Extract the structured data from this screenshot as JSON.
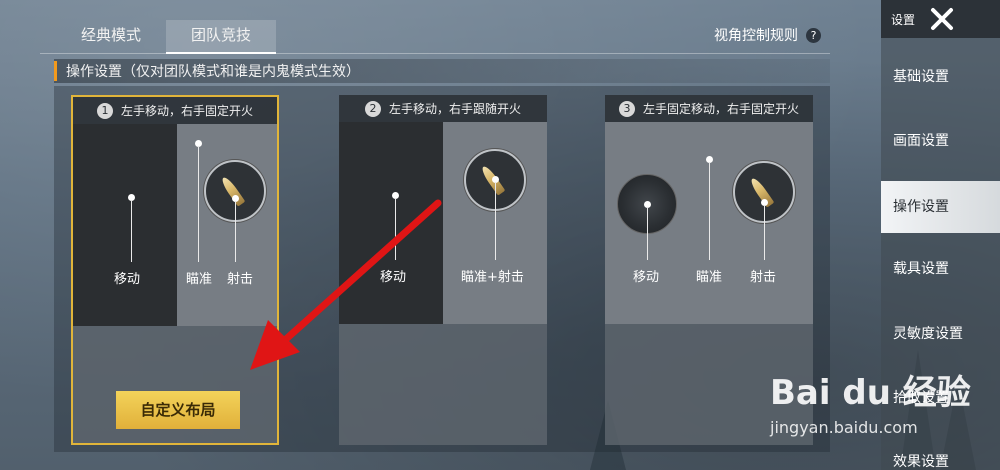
{
  "tabs": [
    {
      "label": "经典模式",
      "active": false
    },
    {
      "label": "团队竞技",
      "active": true
    }
  ],
  "header": {
    "view_rules": "视角控制规则",
    "help": "?"
  },
  "section": {
    "title": "操作设置（仅对团队模式和谁是内鬼模式生效）"
  },
  "cards": [
    {
      "num": "1",
      "title": "左手移动，右手固定开火",
      "selected": true,
      "labels": {
        "move": "移动",
        "aim": "瞄准",
        "shoot": "射击"
      }
    },
    {
      "num": "2",
      "title": "左手移动，右手跟随开火",
      "selected": false,
      "labels": {
        "move": "移动",
        "aim_shoot": "瞄准+射击"
      }
    },
    {
      "num": "3",
      "title": "左手固定移动，右手固定开火",
      "selected": false,
      "labels": {
        "move": "移动",
        "aim": "瞄准",
        "shoot": "射击"
      }
    }
  ],
  "custom_button": "自定义布局",
  "sidebar": {
    "title": "设置",
    "items": [
      {
        "label": "基础设置",
        "active": false
      },
      {
        "label": "画面设置",
        "active": false
      },
      {
        "label": "操作设置",
        "active": true
      },
      {
        "label": "载具设置",
        "active": false
      },
      {
        "label": "灵敏度设置",
        "active": false
      },
      {
        "label": "拾取设置",
        "active": false
      },
      {
        "label": "效果设置",
        "active": false
      }
    ]
  },
  "watermark": {
    "logo": "Bai du 经验",
    "url": "jingyan.baidu.com"
  },
  "colors": {
    "accent_gold": "#e1b53a",
    "section_bar": "#f39a1d",
    "arrow": "#e01515"
  }
}
